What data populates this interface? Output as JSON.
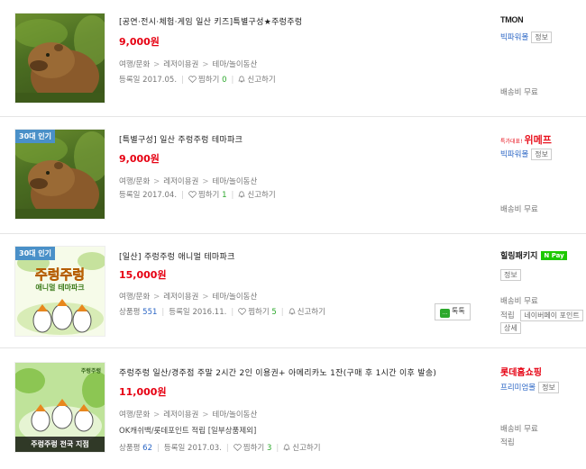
{
  "items": [
    {
      "title": "[공연·전시·체험·게임 일산 키즈]특별구성★주렁주렁",
      "price": "9,000원",
      "cats": [
        "여행/문화",
        "레저이용권",
        "테마/놀이동산"
      ],
      "reg_label": "등록일",
      "reg_date": "2017.05.",
      "wish_label": "찜하기",
      "wish_count": "0",
      "report_label": "신고하기",
      "mall": "TMON",
      "mall_sub": "빅파워몰",
      "info": "정보",
      "ship": "배송비 무료"
    },
    {
      "badge": "30대 인기",
      "title": "[특별구성] 일산 주렁주렁 테마파크",
      "price": "9,000원",
      "cats": [
        "여행/문화",
        "레저이용권",
        "테마/놀이동산"
      ],
      "reg_label": "등록일",
      "reg_date": "2017.04.",
      "wish_label": "찜하기",
      "wish_count": "1",
      "report_label": "신고하기",
      "mall_prefix": "특가대표!",
      "mall": "위메프",
      "mall_sub": "빅파워몰",
      "info": "정보",
      "ship": "배송비 무료"
    },
    {
      "badge": "30대 인기",
      "title": "[일산] 주렁주렁 애니멀 테마파크",
      "price": "15,000원",
      "cats": [
        "여행/문화",
        "레저이용권",
        "테마/놀이동산"
      ],
      "review_label": "상품평",
      "review_count": "551",
      "reg_label": "등록일",
      "reg_date": "2016.11.",
      "wish_label": "찜하기",
      "wish_count": "5",
      "report_label": "신고하기",
      "talk": "톡톡",
      "mall": "힐링패키지",
      "npay": "N Pay",
      "info": "정보",
      "ship": "배송비 무료",
      "point_label": "적립",
      "point_value": "네이버페이 포인트",
      "detail": "상세",
      "thumb_text": "주렁주렁",
      "thumb_sub": "애니멀 테마파크"
    },
    {
      "badge_bottom": "주렁주렁 전국 지점",
      "title": "주렁주렁 일산/경주점 주말 2시간 2인 이용권+ 아메리카노 1잔(구매 후 1시간 이후 발송)",
      "price": "11,000원",
      "cats": [
        "여행/문화",
        "레저이용권",
        "테마/놀이동산"
      ],
      "extra": "OK캐쉬백/롯데포인트 적립 [일부상품제외]",
      "review_label": "상품평",
      "review_count": "62",
      "reg_label": "등록일",
      "reg_date": "2017.03.",
      "wish_label": "찜하기",
      "wish_count": "3",
      "report_label": "신고하기",
      "mall": "롯데홈쇼핑",
      "mall_sub": "프리미엄몰",
      "info": "정보",
      "ship": "배송비 무료",
      "point_label": "적립",
      "thumb_logo": "주렁주렁"
    }
  ],
  "colors": {
    "price": "#e60012",
    "link": "#2b66c5",
    "badge": "#4a90c8",
    "count": "#2ca82c",
    "wemakeprice": "#e8121e",
    "lotte": "#e60012"
  }
}
